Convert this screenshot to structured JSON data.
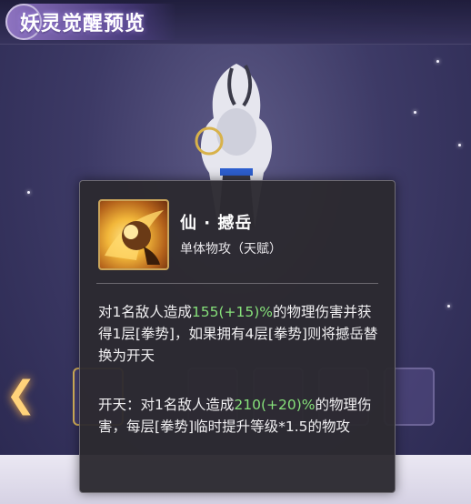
{
  "header": {
    "title": "妖灵觉醒预览"
  },
  "carousel": {
    "arrow_left_glyph": "❮"
  },
  "skill": {
    "name": "仙 · 撼岳",
    "type": "单体物攻（天赋）",
    "icon": "fist-strike-icon",
    "desc1": {
      "p1": "对1名敌人造成",
      "v1": "155(+15)%",
      "p2": "的物理伤害并获得1层[拳势]，如果拥有4层[拳势]则将撼岳替换为开天"
    },
    "desc2": {
      "p1": "开天：对1名敌人造成",
      "v1": "210(+20)%",
      "p2": "的物理伤害，每层[拳势]临时提升等级*1.5的物攻"
    }
  },
  "colors": {
    "highlight": "#86e07a",
    "tooltip_bg": "#2c2a30",
    "title_glow": "#b496ff",
    "arrow": "#ffd27a"
  }
}
